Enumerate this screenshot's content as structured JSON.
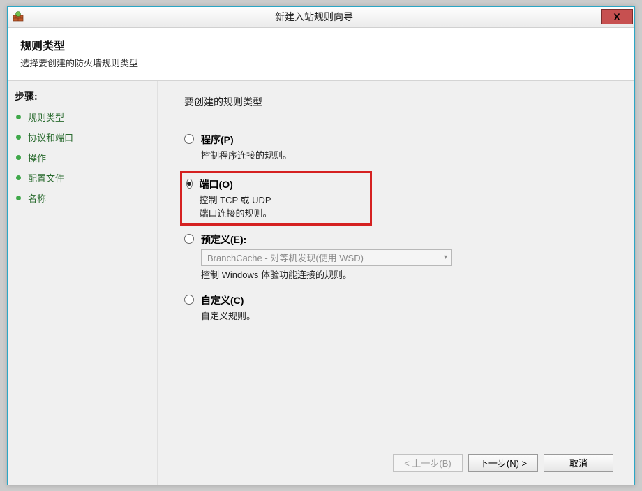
{
  "window": {
    "title": "新建入站规则向导",
    "close_label": "X"
  },
  "header": {
    "title": "规则类型",
    "subtitle": "选择要创建的防火墙规则类型"
  },
  "sidebar": {
    "steps_label": "步骤:",
    "items": [
      {
        "label": "规则类型"
      },
      {
        "label": "协议和端口"
      },
      {
        "label": "操作"
      },
      {
        "label": "配置文件"
      },
      {
        "label": "名称"
      }
    ]
  },
  "main": {
    "prompt": "要创建的规则类型",
    "options": [
      {
        "title": "程序(P)",
        "desc": "控制程序连接的规则。",
        "checked": false,
        "dropdown": false
      },
      {
        "title": "端口(O)",
        "desc": "控制 TCP 或 UDP 端口连接的规则。",
        "checked": true,
        "dropdown": false,
        "highlight": true
      },
      {
        "title": "预定义(E):",
        "desc": "控制 Windows 体验功能连接的规则。",
        "checked": false,
        "dropdown": true,
        "dropdown_value": "BranchCache - 对等机发现(使用 WSD)"
      },
      {
        "title": "自定义(C)",
        "desc": "自定义规则。",
        "checked": false,
        "dropdown": false
      }
    ]
  },
  "buttons": {
    "back": "< 上一步(B)",
    "next": "下一步(N) >",
    "cancel": "取消"
  }
}
